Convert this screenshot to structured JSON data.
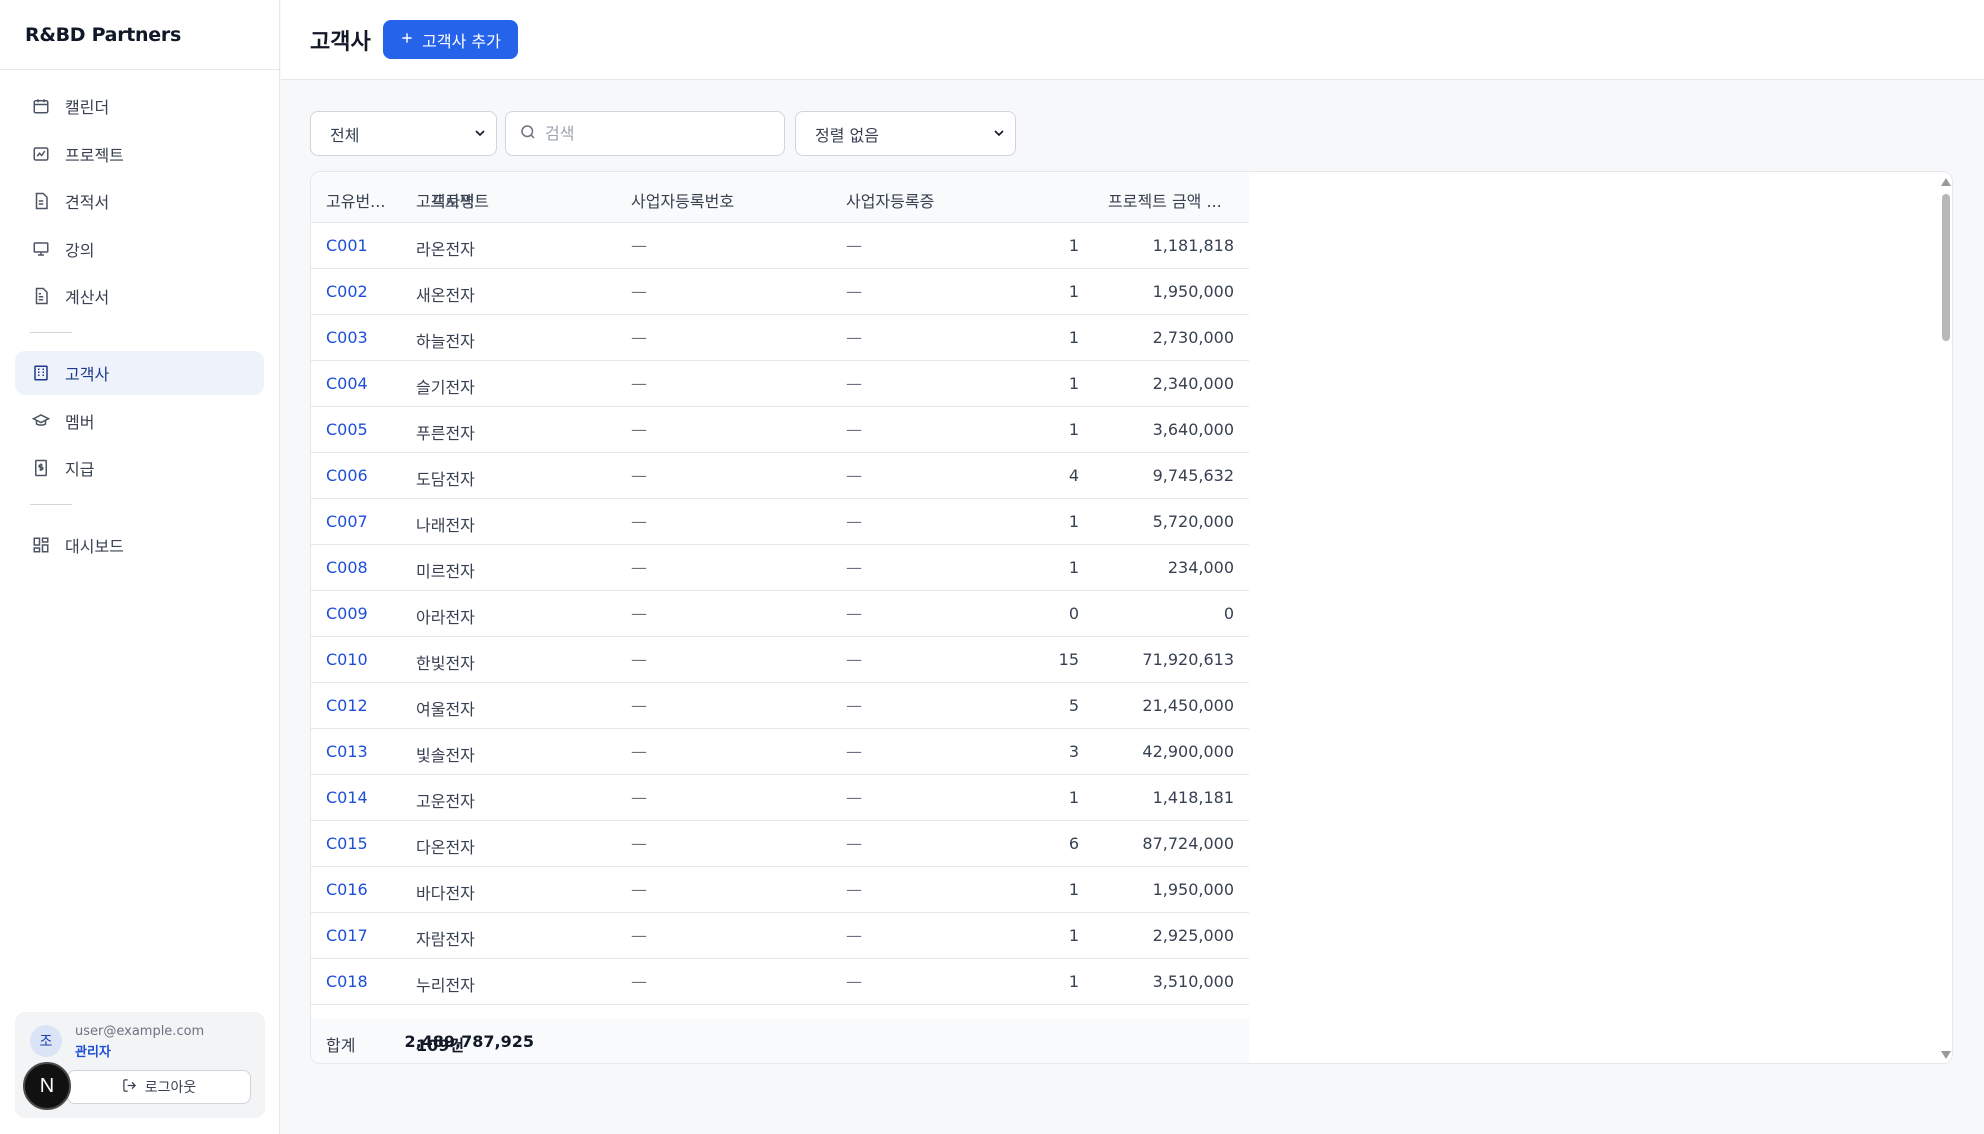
{
  "brand": "R&BD Partners",
  "sidebar": {
    "items": [
      {
        "label": "캘린더",
        "icon": "calendar-icon"
      },
      {
        "label": "프로젝트",
        "icon": "project-icon"
      },
      {
        "label": "견적서",
        "icon": "quote-icon"
      },
      {
        "label": "강의",
        "icon": "presentation-icon"
      },
      {
        "label": "계산서",
        "icon": "invoice-icon"
      },
      {
        "label": "고객사",
        "icon": "building-icon"
      },
      {
        "label": "멤버",
        "icon": "graduation-cap-icon"
      },
      {
        "label": "지급",
        "icon": "payment-icon"
      },
      {
        "label": "대시보드",
        "icon": "dashboard-icon"
      }
    ],
    "active": "고객사"
  },
  "user": {
    "avatar": "조",
    "email": "user@example.com",
    "role": "관리자",
    "logout_label": "로그아웃"
  },
  "n_badge": "N",
  "header": {
    "title": "고객사",
    "add_button": "고객사 추가"
  },
  "filters": {
    "type_value": "전체",
    "search_placeholder": "검색",
    "sort_value": "정렬 없음"
  },
  "table": {
    "columns": [
      "고유번...",
      "고객사명",
      "사업자등록번호",
      "사업자등록증",
      "프로젝트",
      "프로젝트 금액 ..."
    ],
    "rows": [
      {
        "code": "C001",
        "name": "라온전자",
        "reg_no": "—",
        "reg_cert": "—",
        "projects": "1",
        "amount": "1,181,818"
      },
      {
        "code": "C002",
        "name": "새온전자",
        "reg_no": "—",
        "reg_cert": "—",
        "projects": "1",
        "amount": "1,950,000"
      },
      {
        "code": "C003",
        "name": "하늘전자",
        "reg_no": "—",
        "reg_cert": "—",
        "projects": "1",
        "amount": "2,730,000"
      },
      {
        "code": "C004",
        "name": "슬기전자",
        "reg_no": "—",
        "reg_cert": "—",
        "projects": "1",
        "amount": "2,340,000"
      },
      {
        "code": "C005",
        "name": "푸른전자",
        "reg_no": "—",
        "reg_cert": "—",
        "projects": "1",
        "amount": "3,640,000"
      },
      {
        "code": "C006",
        "name": "도담전자",
        "reg_no": "—",
        "reg_cert": "—",
        "projects": "4",
        "amount": "9,745,632"
      },
      {
        "code": "C007",
        "name": "나래전자",
        "reg_no": "—",
        "reg_cert": "—",
        "projects": "1",
        "amount": "5,720,000"
      },
      {
        "code": "C008",
        "name": "미르전자",
        "reg_no": "—",
        "reg_cert": "—",
        "projects": "1",
        "amount": "234,000"
      },
      {
        "code": "C009",
        "name": "아라전자",
        "reg_no": "—",
        "reg_cert": "—",
        "projects": "0",
        "amount": "0"
      },
      {
        "code": "C010",
        "name": "한빛전자",
        "reg_no": "—",
        "reg_cert": "—",
        "projects": "15",
        "amount": "71,920,613"
      },
      {
        "code": "C012",
        "name": "여울전자",
        "reg_no": "—",
        "reg_cert": "—",
        "projects": "5",
        "amount": "21,450,000"
      },
      {
        "code": "C013",
        "name": "빛솔전자",
        "reg_no": "—",
        "reg_cert": "—",
        "projects": "3",
        "amount": "42,900,000"
      },
      {
        "code": "C014",
        "name": "고운전자",
        "reg_no": "—",
        "reg_cert": "—",
        "projects": "1",
        "amount": "1,418,181"
      },
      {
        "code": "C015",
        "name": "다온전자",
        "reg_no": "—",
        "reg_cert": "—",
        "projects": "6",
        "amount": "87,724,000"
      },
      {
        "code": "C016",
        "name": "바다전자",
        "reg_no": "—",
        "reg_cert": "—",
        "projects": "1",
        "amount": "1,950,000"
      },
      {
        "code": "C017",
        "name": "자람전자",
        "reg_no": "—",
        "reg_cert": "—",
        "projects": "1",
        "amount": "2,925,000"
      },
      {
        "code": "C018",
        "name": "누리전자",
        "reg_no": "—",
        "reg_cert": "—",
        "projects": "1",
        "amount": "3,510,000"
      }
    ],
    "footer": {
      "label": "합계",
      "count": "109건",
      "total": "2,489,787,925"
    }
  },
  "colors": {
    "accent": "#2563eb",
    "link": "#1d4ed8",
    "active_nav_bg": "#eef2fb"
  }
}
